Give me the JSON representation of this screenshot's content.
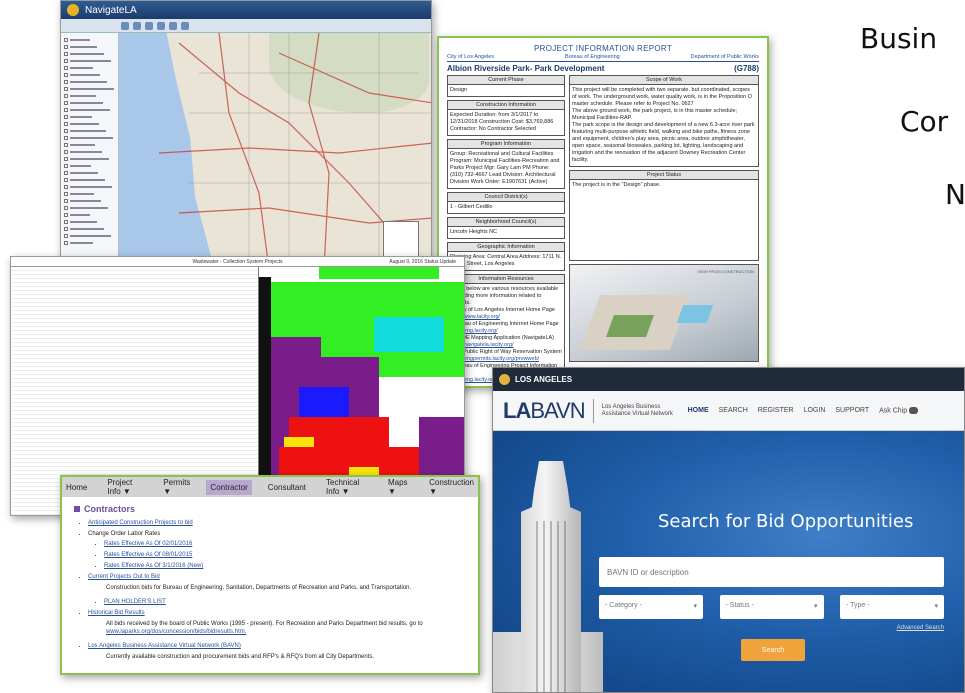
{
  "slide": {
    "text_lines": [
      "Busin",
      "Cor",
      "N"
    ]
  },
  "map_panel": {
    "app_title": "NavigateLA"
  },
  "report": {
    "title": "PROJECT INFORMATION REPORT",
    "org_left": "City of Los Angeles",
    "org_center": "Bureau of Engineering",
    "org_right": "Department of Public Works",
    "project_name": "Albion Riverside Park- Park Development",
    "project_id": "(G788)",
    "current_phase_hdr": "Current Phase",
    "current_phase": "Design",
    "scope_hdr": "Scope of Work",
    "scope_text_1": "This project will be completed with two separate, but coordinated, scopes of work. The underground work, water quality work, is in the Proposition O master schedule. Please refer to Project No. 0627",
    "scope_text_2": "The above ground work, the park project, is in this master schedule; Municipal Facilities-RAP.",
    "scope_text_3": "The park scope is the design and development of a new 6.3-acre river park featuring multi-purpose athletic field, walking and bike paths, fitness zone and equipment, children's play area, picnic area, outdoor amphitheater, open space, seasonal bioswales, parking lot, lighting, landscaping and irrigation and the renovation of the adjacent Downey Recreation Center facility.",
    "construction_hdr": "Construction Information",
    "construction_text": "Expected Duration: from 3/1/2017 to 12/31/2018 Construction Cost: $3,769,886 Contractor: No Contractor Selected",
    "program_hdr": "Program Information",
    "program_text": "Group: Recreational and Cultural Facilities Program: Municipal Facilities-Recreation and Parks Project Mgr: Gary Lam PM Phone: (310) 732-4667 Lead Division: Architectural Division Work Order: E1907631 (Active)",
    "council_hdr": "Council District(s)",
    "council_text": "1 - Gilbert Cedillo",
    "status_hdr": "Project Status",
    "status_text": "The project is in the \"Design\" phase.",
    "neighborhood_hdr": "Neighborhood Council(s)",
    "neighborhood_text": "Lincoln Heights NC",
    "geo_hdr": "Geographic Information",
    "geo_text": "Planning Area: Central Area Address: 1711 N. Albion Street, Los Angeles",
    "resources_hdr": "Information Resources",
    "resources_text": "Listed below are various resources available for finding more information related to projects.",
    "res_1": "City of Los Angeles Internet Home Page",
    "res_1_url": "http://www.lacity.org/",
    "res_2": "Bureau of Engineering Internet Home Page",
    "res_2_url": "http://eng.lacity.org/",
    "res_3": "BOE Mapping Application (NavigateLA)",
    "res_3_url": "http://navigatela.lacity.org/",
    "res_4": "BOE Public Right of Way Reservation System",
    "res_4_url": "http://engpermits.lacity.org/prowweb/",
    "res_5": "Bureau of Engineering Project Information Reports",
    "res_5_url": "http://eng.lacity.org/pirs/",
    "render_caption": "VIEW FROM CONSTRUCTION"
  },
  "gantt": {
    "title": "Wastewater - Collection System Projects",
    "date_label": "August 9, 2016 Status Update",
    "colors": {
      "lime": "#33ee22",
      "cyan": "#11dddd",
      "purple": "#7a1d8a",
      "blue": "#1a1aff",
      "red": "#ee1111",
      "yellow": "#f7e40a",
      "black": "#111111"
    }
  },
  "contractor": {
    "nav": {
      "home": "Home",
      "project_info": "Project Info",
      "permits": "Permits",
      "contractor": "Contractor",
      "consultant": "Consultant",
      "technical_info": "Technical Info",
      "maps": "Maps",
      "construction": "Construction",
      "arrow": "▼"
    },
    "heading": "Contractors",
    "items": {
      "anticipated": "Anticipated Construction Projects to bid",
      "change_order": "Change Order Labor Rates",
      "rate_1": "Rates Effective As Of 02/01/2016",
      "rate_2": "Rates Effective As Of 08/01/2015",
      "rate_3": "Rates Effective As Of 3/1/2016 (New)",
      "current": "Current Projects Out to Bid",
      "current_desc": "Construction bids for Bureau of Engineering, Sanitation, Departments of Recreation and Parks, and Transportation.",
      "plan_holders": "PLAN HOLDER'S LIST",
      "historical": "Historical Bid Results",
      "historical_desc": "All bids received by the board of Public Works (1995 - present). For Recreation and Parks Department bid results, go to",
      "historical_url": "www.laparks.org/dos/concession/bids/bidresults.htm.",
      "labavn": "Los Angeles Business Assistance Virtual Network (BAVN)",
      "labavn_desc": "Currently available construction and procurement bids and RFP's & RFQ's from all City Departments."
    }
  },
  "labavn": {
    "topbar": "LOS ANGELES",
    "logo_bold": "LA",
    "logo_thin": "BAVN",
    "tagline": "Los Angeles Business Assistance Virtual Network",
    "nav": {
      "home": "HOME",
      "search": "SEARCH",
      "register": "REGISTER",
      "login": "LOGIN",
      "support": "SUPPORT",
      "ask": "Ask Chip"
    },
    "hero_title": "Search for Bid Opportunities",
    "search_placeholder": "BAVN ID or description",
    "category": "- Category -",
    "status": "- Status -",
    "type": "- Type -",
    "select_arrow": "▾",
    "advanced": "Advanced Search",
    "search_button": "Search"
  }
}
